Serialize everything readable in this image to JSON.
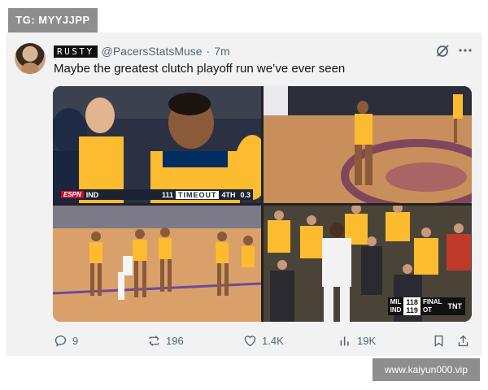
{
  "overlay": {
    "tag_text": "TG: MYYJJPP",
    "watermark_text": "www.kaiyun000.vip"
  },
  "tweet": {
    "display_name": "RUSTY",
    "handle": "@PacersStatsMuse",
    "separator": "·",
    "time": "7m",
    "text": "Maybe the greatest clutch playoff run we’ve ever seen"
  },
  "media": {
    "panel1": {
      "network": "ESPN",
      "team": "IND",
      "score": "111",
      "status": "TIMEOUT",
      "quarter": "4TH",
      "clock": "0.3"
    },
    "panel4": {
      "team1": "MIL",
      "score1": "118",
      "team2": "IND",
      "score2": "119",
      "final_label": "FINAL",
      "ot_label": "OT",
      "network": "TNT"
    }
  },
  "actions": {
    "replies": "9",
    "reposts": "196",
    "likes": "1.4K",
    "views": "19K"
  },
  "colors": {
    "pacers_gold": "#fdbb30",
    "pacers_navy": "#002d62",
    "muted_text": "#536471"
  }
}
